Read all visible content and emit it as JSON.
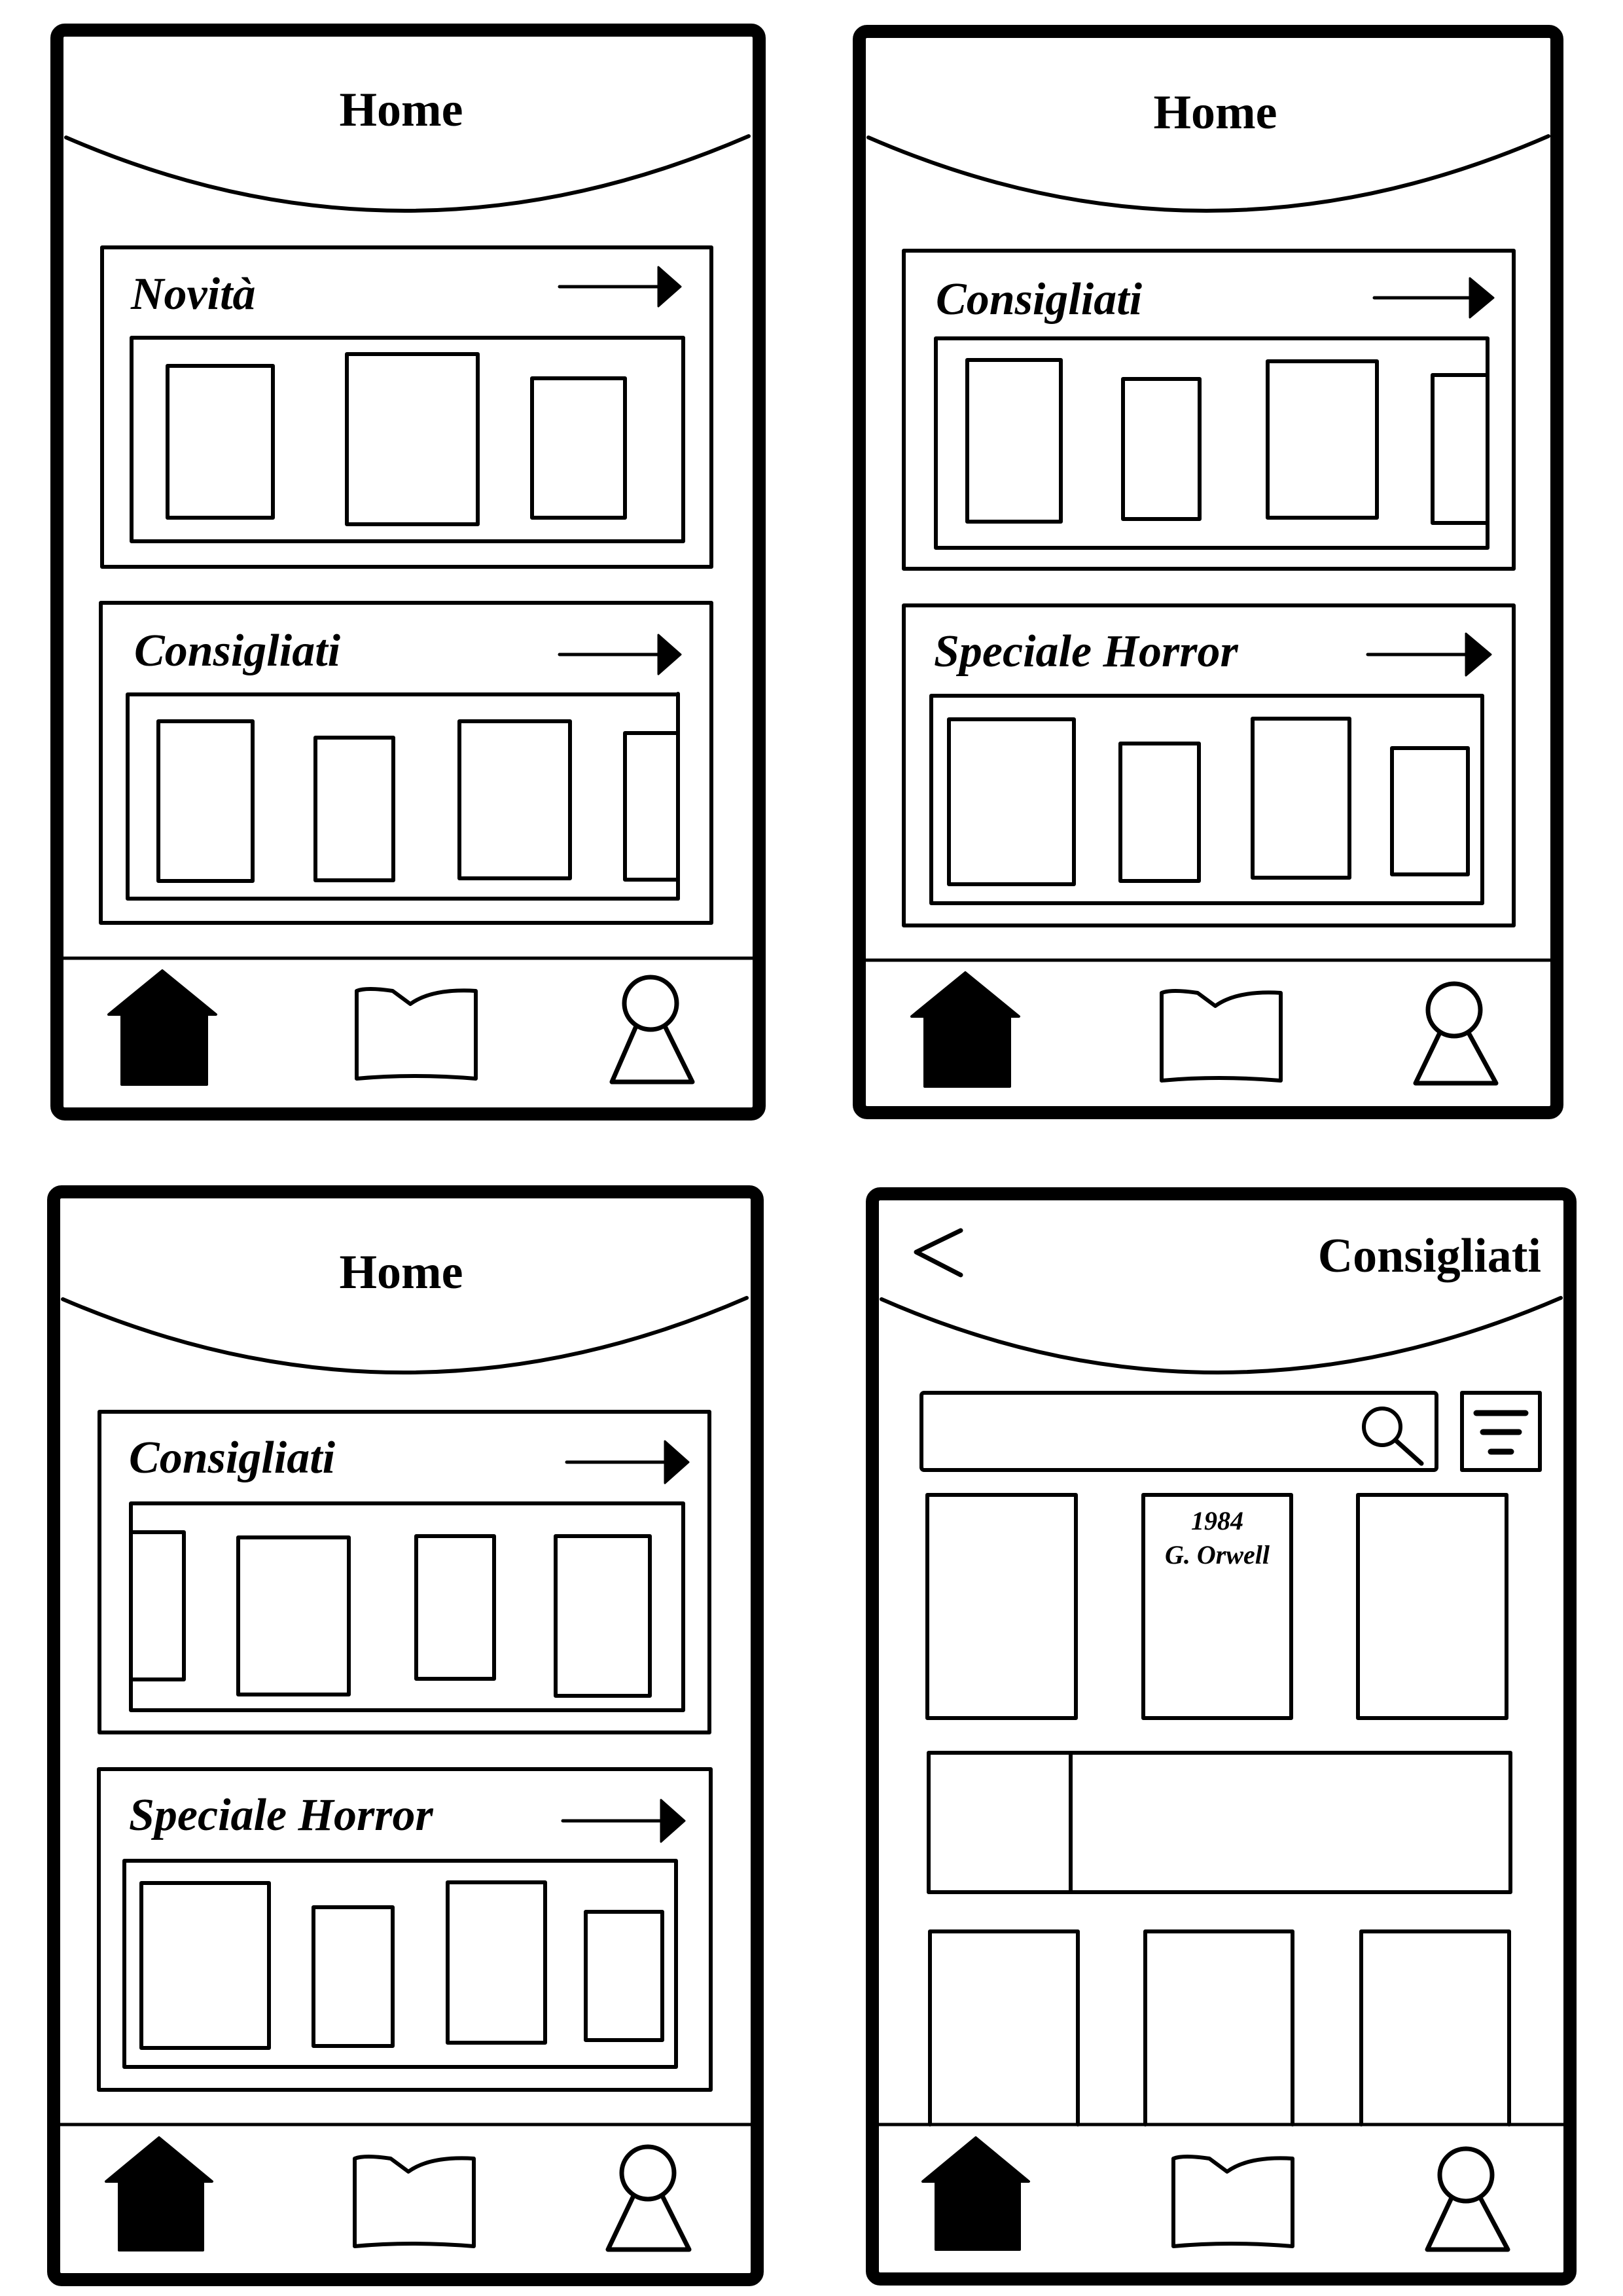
{
  "colors": {
    "ink": "#000000",
    "paper": "#ffffff"
  },
  "screens": [
    {
      "title": "Home",
      "sections": [
        {
          "label": "Novità"
        },
        {
          "label": "Consigliati"
        }
      ],
      "tabbar": {
        "active": "home"
      }
    },
    {
      "title": "Home",
      "sections": [
        {
          "label": "Consigliati"
        },
        {
          "label": "Speciale Horror"
        }
      ],
      "tabbar": {
        "active": "home"
      }
    },
    {
      "title": "Home",
      "sections": [
        {
          "label": "Consigliati"
        },
        {
          "label": "Speciale Horror"
        }
      ],
      "tabbar": {
        "active": "home"
      }
    },
    {
      "title": "Consigliati",
      "back_icon": "chevron-left-icon",
      "search_icon": "search-icon",
      "filter_icon": "filter-icon",
      "featured_book": {
        "title": "1984",
        "author": "G. Orwell"
      },
      "tabbar": {
        "active": "home"
      }
    }
  ],
  "tab_icons": [
    "home-icon",
    "book-icon",
    "profile-icon"
  ]
}
